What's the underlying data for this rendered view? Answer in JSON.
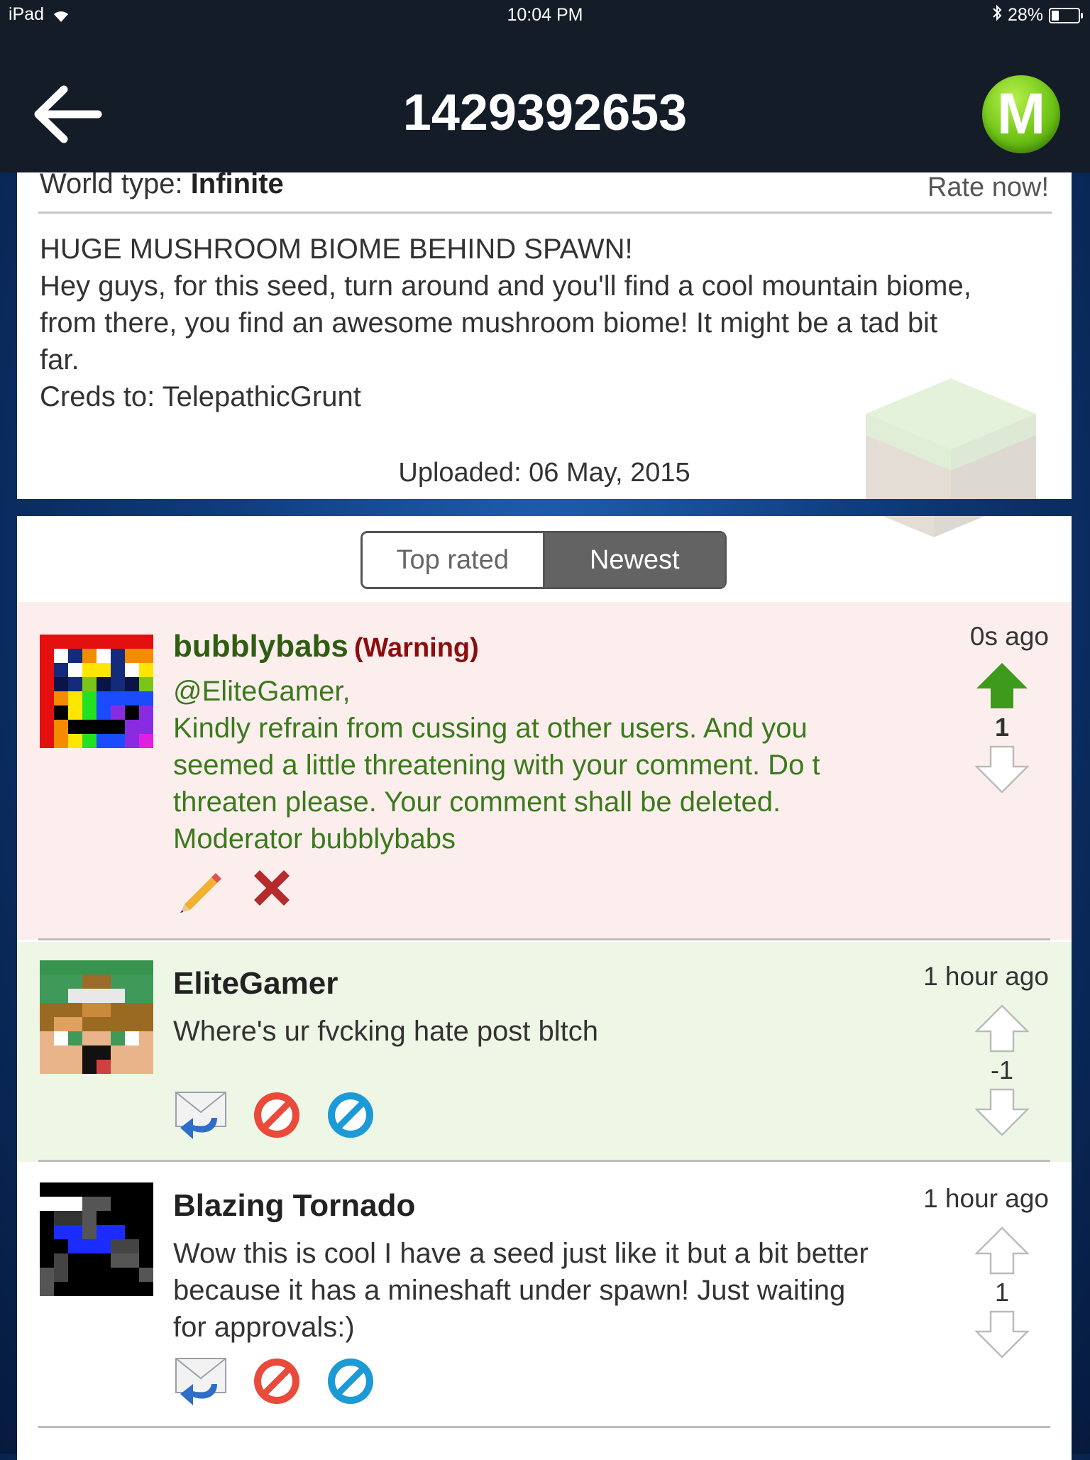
{
  "status_bar": {
    "device": "iPad",
    "time": "10:04 PM",
    "battery_text": "28%",
    "battery_level": 0.28
  },
  "header": {
    "title": "1429392653",
    "logo_letter": "M"
  },
  "seed_info": {
    "world_type_label": "World type:",
    "world_type_value": "Infinite",
    "rate_label": "Rate now!",
    "description_lines": [
      "HUGE MUSHROOM BIOME BEHIND SPAWN!",
      "Hey guys, for this seed, turn around and you'll find a cool mountain biome,",
      "from there, you find an awesome mushroom biome! It might be a tad bit",
      "far.",
      "Creds to: TelepathicGrunt"
    ],
    "uploaded": "Uploaded: 06 May, 2015"
  },
  "sort_tabs": {
    "top_rated": "Top rated",
    "newest": "Newest",
    "selected": "Newest"
  },
  "comments": [
    {
      "author": "bubblybabs",
      "tag": "(Warning)",
      "time": "0s ago",
      "score": "1",
      "vote_state": "up",
      "body_lines": [
        "@EliteGamer,",
        "Kindly refrain from cussing at other users. And you",
        "seemed a little threatening with your comment. Do t",
        "threaten please. Your comment shall be deleted.",
        "Moderator bubblybabs"
      ],
      "actions": [
        "pencil-icon",
        "delete-x-icon"
      ]
    },
    {
      "author": "EliteGamer",
      "time": "1 hour ago",
      "score": "-1",
      "vote_state": "none",
      "body_lines": [
        "Where's ur fvcking hate post bltch"
      ],
      "actions": [
        "reply-mail-icon",
        "block-icon",
        "report-icon"
      ]
    },
    {
      "author": "Blazing Tornado",
      "time": "1 hour ago",
      "score": "1",
      "vote_state": "none",
      "body_lines": [
        "Wow this is cool I have a seed just like it but a bit better",
        "because it has a mineshaft under spawn! Just waiting",
        "for approvals:)"
      ],
      "actions": [
        "reply-mail-icon",
        "block-icon",
        "report-icon"
      ]
    }
  ],
  "colors": {
    "header_bg": "#141c28",
    "moderator_bg": "#fdeeee",
    "moderator_text": "#3b7a1b",
    "warning_text": "#8c0d0d",
    "highlight_bg": "#eef7e6",
    "upvote_active": "#3e9a1a",
    "logo_green": "#6fc417"
  }
}
